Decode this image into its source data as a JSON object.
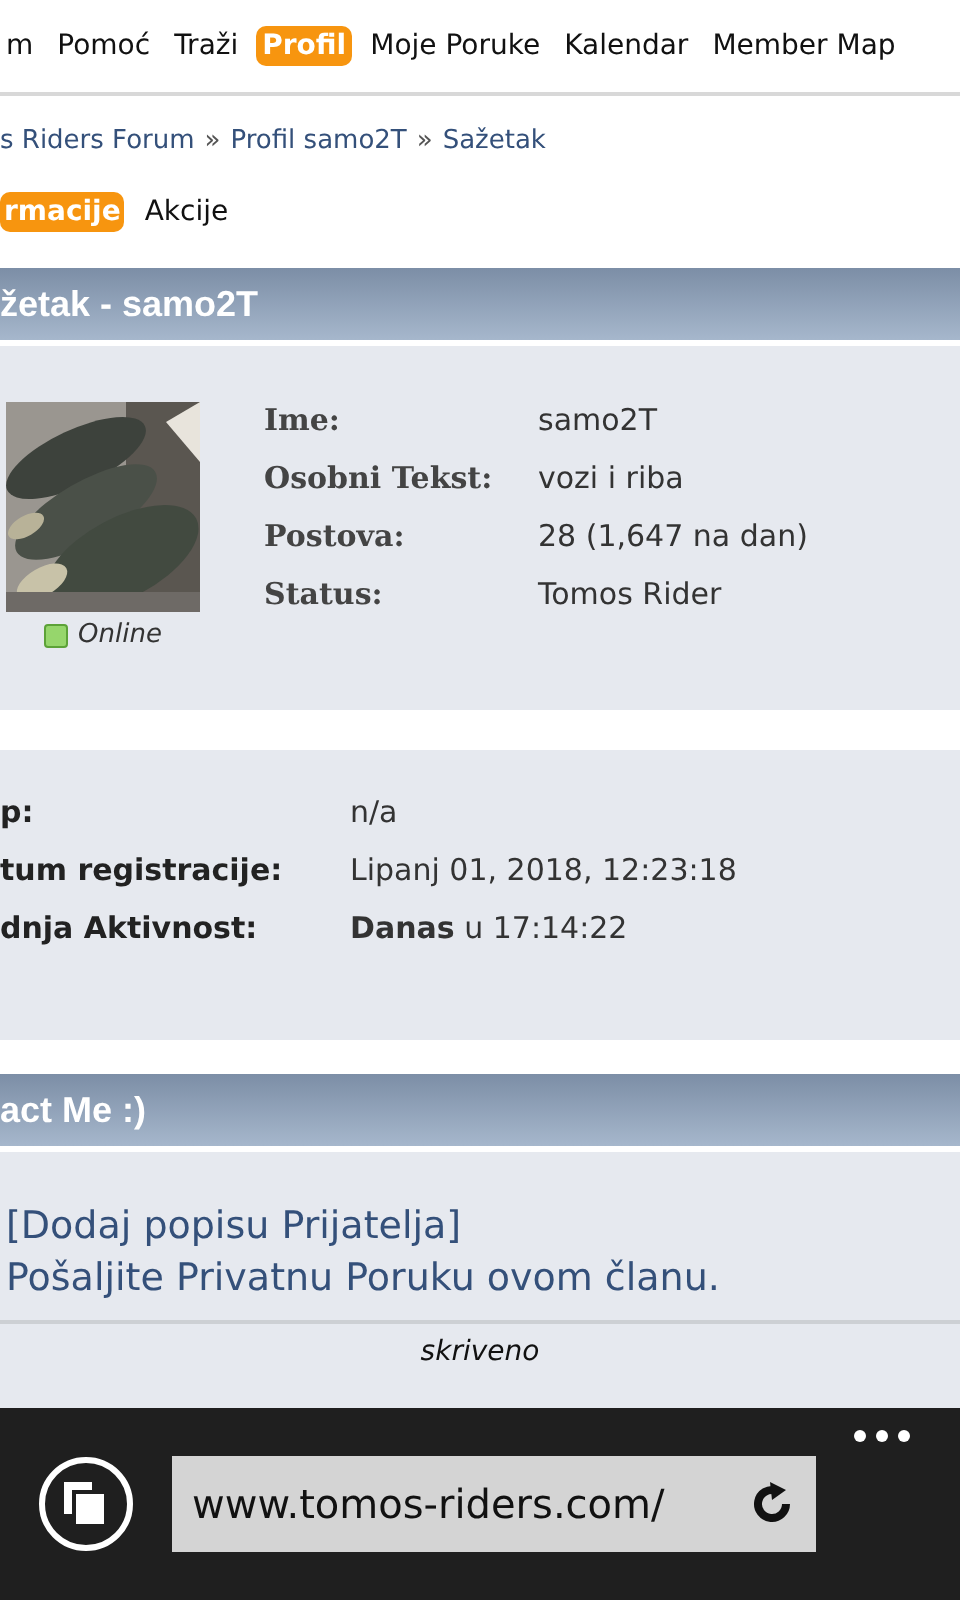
{
  "nav": [
    {
      "label": "m",
      "selected": false
    },
    {
      "label": "Pomoć",
      "selected": false
    },
    {
      "label": "Traži",
      "selected": false
    },
    {
      "label": "Profil",
      "selected": true
    },
    {
      "label": "Moje Poruke",
      "selected": false
    },
    {
      "label": "Kalendar",
      "selected": false
    },
    {
      "label": "Member Map",
      "selected": false
    }
  ],
  "breadcrumb": [
    "s Riders Forum",
    "Profil samo2T",
    "Sažetak"
  ],
  "breadcrumb_separator": "»",
  "subtabs": [
    {
      "label": "rmacije",
      "selected": true
    },
    {
      "label": "Akcije",
      "selected": false
    }
  ],
  "summary": {
    "title": "žetak - samo2T",
    "online": true,
    "status_label": "Online",
    "fields": [
      {
        "label": "Ime:",
        "value": "samo2T"
      },
      {
        "label": "Osobni Tekst:",
        "value": "vozi i riba"
      },
      {
        "label": "Postova:",
        "value": "28 (1,647 na dan)"
      },
      {
        "label": "Status:",
        "value": "Tomos Rider"
      }
    ]
  },
  "details": [
    {
      "label": "p:",
      "value": "n/a"
    },
    {
      "label": "tum registracije:",
      "value": "Lipanj 01, 2018, 12:23:18"
    },
    {
      "label": "dnja Aktivnost:",
      "value": "**Danas** u 17:14:22"
    }
  ],
  "contact": {
    "title": "act Me :)",
    "links": [
      "[Dodaj popisu Prijatelja]",
      "Pošaljite Privatnu Poruku ovom članu."
    ],
    "footer": "skriveno"
  },
  "browser": {
    "url": "www.tomos-riders.com/"
  }
}
